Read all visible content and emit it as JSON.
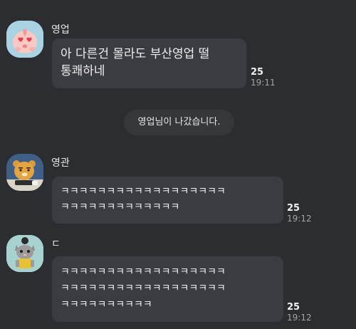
{
  "chat": {
    "messages": [
      {
        "sender": "영업",
        "avatar_icon": "apeach-heart-eyes-avatar-icon",
        "lines": [
          "아 다른건 몰라도 부산영업 떨",
          "통쾌하네"
        ],
        "unread": "25",
        "time": "19:11"
      },
      {
        "sender": "영관",
        "avatar_icon": "ryan-avatar-icon",
        "lines": [
          "ㅋㅋㅋㅋㅋㅋㅋㅋㅋㅋㅋㅋㅋㅋㅋㅋㅋㅋ",
          "ㅋㅋㅋㅋㅋㅋㅋㅋㅋㅋㅋㅋㅋ"
        ],
        "unread": "25",
        "time": "19:12"
      },
      {
        "sender": "ㄷ",
        "avatar_icon": "cat-avatar-icon",
        "lines": [
          "ㅋㅋㅋㅋㅋㅋㅋㅋㅋㅋㅋㅋㅋㅋㅋㅋㅋㅋ",
          "ㅋㅋㅋㅋㅋㅋㅋㅋㅋㅋㅋㅋㅋㅋㅋㅋㅋㅋ",
          "ㅋㅋㅋㅋㅋㅋㅋㅋㅋㅋ"
        ],
        "unread": "25",
        "time": "19:12"
      }
    ],
    "system_notice": "영업님이 나갔습니다."
  },
  "colors": {
    "background": "#2c2d31",
    "bubble": "#3b3c41",
    "notice": "#36373b",
    "time_text": "#a3a4a8"
  }
}
